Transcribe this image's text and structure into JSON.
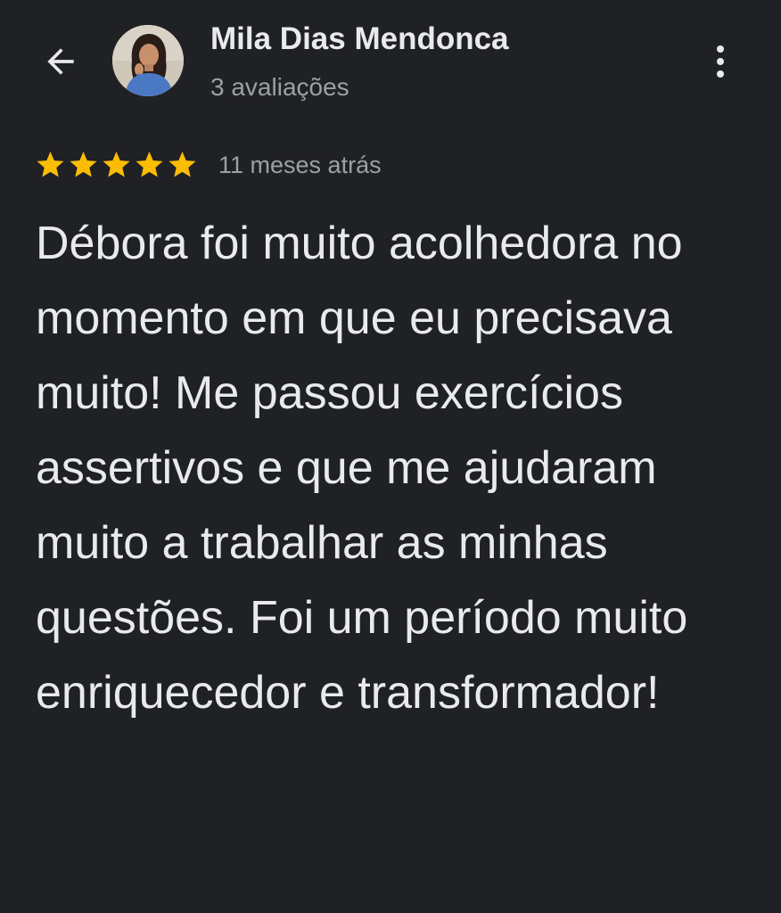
{
  "header": {
    "back_icon": "arrow-back-icon",
    "user_name": "Mila Dias Mendonca",
    "review_count": "3 avaliações",
    "more_icon": "more-vert-icon"
  },
  "review": {
    "rating": 5,
    "rating_max": 5,
    "star_color": "#fbbc04",
    "time": "11 meses atrás",
    "text": "Débora foi muito acolhedora no momento em que eu precisava muito! Me passou exercícios assertivos e que me ajudaram muito a trabalhar as minhas questões. Foi um período muito enriquecedor e transformador!"
  },
  "colors": {
    "background": "#202124",
    "primary_text": "#e8eaed",
    "secondary_text": "#9aa0a6"
  }
}
